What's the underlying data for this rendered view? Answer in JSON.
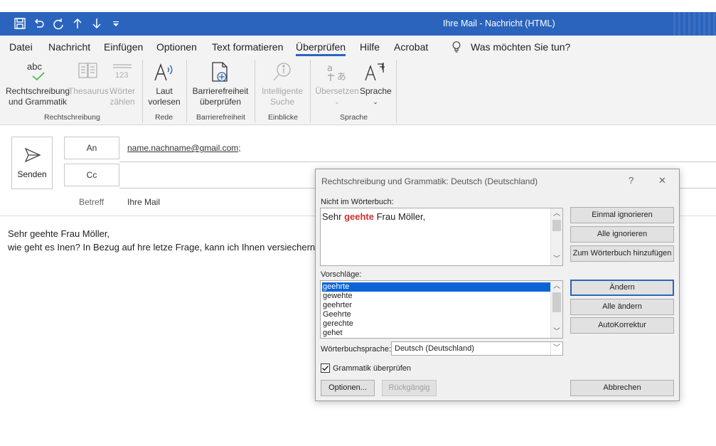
{
  "window": {
    "title": "Ihre Mail  -  Nachricht (HTML)",
    "accent": "#2b64bd"
  },
  "quick_access": [
    "save-icon",
    "undo-icon",
    "redo-icon",
    "up-arrow-icon",
    "down-arrow-icon",
    "customize-icon"
  ],
  "tabs": [
    {
      "label": "Datei"
    },
    {
      "label": "Nachricht"
    },
    {
      "label": "Einfügen"
    },
    {
      "label": "Optionen"
    },
    {
      "label": "Text formatieren"
    },
    {
      "label": "Überprüfen",
      "active": true
    },
    {
      "label": "Hilfe"
    },
    {
      "label": "Acrobat"
    }
  ],
  "tell_me": "Was möchten Sie tun?",
  "ribbon": {
    "spelling": {
      "line1": "Rechtschreibung",
      "line2": "und Grammatik",
      "icon_text": "abc"
    },
    "thesaurus": {
      "label": "Thesaurus"
    },
    "wordcount": {
      "line1": "Wörter",
      "line2": "zählen",
      "icon_text": "123"
    },
    "read_aloud": {
      "line1": "Laut",
      "line2": "vorlesen"
    },
    "accessibility": {
      "line1": "Barrierefreiheit",
      "line2": "überprüfen"
    },
    "smart_lookup": {
      "line1": "Intelligente",
      "line2": "Suche"
    },
    "translate": {
      "label": "Übersetzen"
    },
    "language": {
      "label": "Sprache"
    },
    "groups": {
      "proofing": "Rechtschreibung",
      "speech": "Rede",
      "accessibility": "Barrierefreiheit",
      "insights": "Einblicke",
      "language": "Sprache"
    }
  },
  "compose": {
    "send": "Senden",
    "to_label": "An",
    "to_value": "name.nachname@gmail.com;",
    "cc_label": "Cc",
    "subject_label": "Betreff",
    "subject_value": "Ihre Mail",
    "body_line1": "Sehr geehte Frau Möller,",
    "body_line2": "wie geht es Inen? In Bezug auf hre letze Frage, kann ich Ihnen versiechern,"
  },
  "dialog": {
    "title": "Rechtschreibung und Grammatik: Deutsch (Deutschland)",
    "help": "?",
    "close": "✕",
    "not_in_dict_label": "Nicht im Wörterbuch:",
    "sentence_before": "Sehr ",
    "error_word": "geehte",
    "sentence_after": " Frau Möller,",
    "error_color": "#d32f2f",
    "suggestions_label": "Vorschläge:",
    "suggestions": [
      "geehrte",
      "gewehte",
      "geehrter",
      "Geehrte",
      "gerechte",
      "gehet"
    ],
    "selected_suggestion": "geehrte",
    "dict_lang_label": "Wörterbuchsprache:",
    "dict_lang_value": "Deutsch (Deutschland)",
    "grammar_check_label": "Grammatik überprüfen",
    "grammar_checked": true,
    "buttons": {
      "ignore_once": "Einmal ignorieren",
      "ignore_all": "Alle ignorieren",
      "add_to_dict": "Zum Wörterbuch hinzufügen",
      "change": "Ändern",
      "change_all": "Alle ändern",
      "autocorrect": "AutoKorrektur",
      "options": "Optionen...",
      "undo": "Rückgängig",
      "cancel": "Abbrechen"
    }
  }
}
